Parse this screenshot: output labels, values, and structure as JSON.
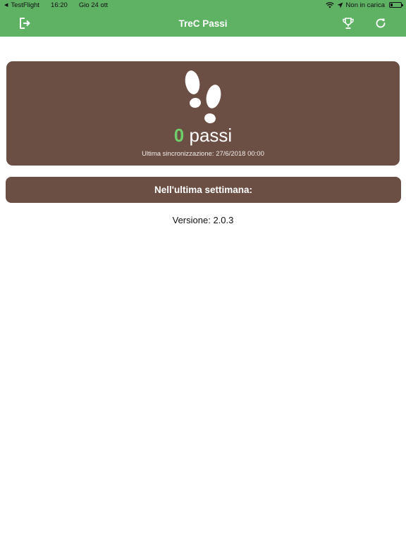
{
  "status_bar": {
    "back_app": "TestFlight",
    "time": "16:20",
    "date": "Gio 24 ott",
    "charging": "Non in carica",
    "icons": [
      "back-triangle-icon",
      "wifi-icon",
      "location-icon",
      "battery-icon"
    ]
  },
  "nav": {
    "title": "TreC Passi",
    "icons": [
      "logout-icon",
      "trophy-icon",
      "refresh-icon"
    ]
  },
  "steps": {
    "count": "0",
    "unit": "passi",
    "last_sync": "Ultima sincronizzazione: 27/6/2018 00:00",
    "icon": "footprints-icon"
  },
  "week": {
    "label": "Nell'ultima settimana:"
  },
  "footer": {
    "version": "Versione: 2.0.3"
  },
  "colors": {
    "accent_green": "#5fb264",
    "card_brown": "#6b4f44",
    "count_green": "#6fce6a"
  }
}
